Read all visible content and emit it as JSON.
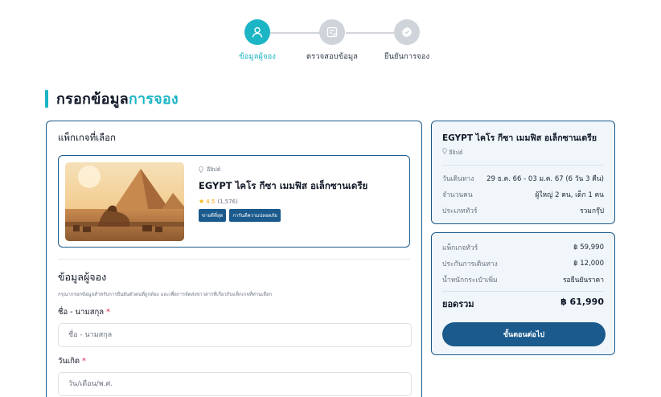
{
  "stepper": {
    "steps": [
      {
        "label": "ข้อมูลผู้จอง",
        "active": true
      },
      {
        "label": "ตรวจสอบข้อมูล",
        "active": false
      },
      {
        "label": "ยืนยันการจอง",
        "active": false
      }
    ]
  },
  "page": {
    "title_main": "กรอกข้อมูล",
    "title_accent": "การจอง"
  },
  "package_section": {
    "label": "แพ็กเกจที่เลือก",
    "location": "อียิปต์",
    "title": "EGYPT ไคโร กีซา เมมฟิส อเล็กซานเดรีย",
    "rating": "4.5",
    "review_count": "(1,576)",
    "badges": [
      "ขายดีที่สุด",
      "การันตีความปลอดภัย"
    ]
  },
  "booker_form": {
    "heading": "ข้อมูลผู้จอง",
    "subtext": "กรุณากรอกข้อมูลสำหรับการยืนยันตัวตนที่ถูกต้อง และเพื่อการจัดส่งข่าวสารที่เกี่ยวกับแพ็กเกจที่ท่านเลือก",
    "name_label": "ชื่อ - นามสกุล",
    "name_placeholder": "ชื่อ - นามสกุล",
    "dob_label": "วันเกิด",
    "dob_placeholder": "วัน/เดือน/พ.ศ.",
    "required_mark": "*"
  },
  "trip_summary": {
    "title": "EGYPT ไคโร กีซา เมมฟิส อเล็กซานเดรีย",
    "location": "อียิปต์",
    "rows": [
      {
        "key": "วันเดินทาง",
        "value": "29 ธ.ค. 66 - 03 ม.ค. 67 (6 วัน 3 คืน)"
      },
      {
        "key": "จำนวนคน",
        "value": "ผู้ใหญ่ 2 คน, เด็ก 1 คน"
      },
      {
        "key": "ประเภททัวร์",
        "value": "รวมกรุ๊ป"
      }
    ]
  },
  "price_summary": {
    "rows": [
      {
        "key": "แพ็กเกจทัวร์",
        "value": "฿ 59,990"
      },
      {
        "key": "ประกันการเดินทาง",
        "value": "฿ 12,000"
      },
      {
        "key": "น้ำหนักกระเป๋าเพิ่ม",
        "value": "รอยืนยันราคา"
      }
    ],
    "total_label": "ยอดรวม",
    "total_value": "฿ 61,990",
    "next_button": "ขั้นตอนต่อไป"
  },
  "colors": {
    "accent": "#1cb5c5",
    "primary": "#1a5a8c",
    "inactive": "#cfd4da",
    "required": "#e11d48"
  },
  "icons": [
    "user-icon",
    "document-check-icon",
    "check-badge-icon",
    "location-pin-icon",
    "star-icon"
  ]
}
